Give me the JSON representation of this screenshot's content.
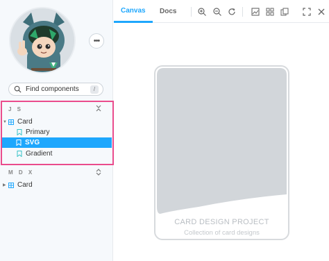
{
  "sidebar": {
    "search": {
      "placeholder": "Find components",
      "shortcut": "/"
    },
    "more_label": "•••",
    "sections": [
      {
        "title": "J S",
        "toggle": "⌃⌄",
        "component": "Card",
        "stories": [
          "Primary",
          "SVG",
          "Gradient"
        ],
        "selected_story": "SVG"
      },
      {
        "title": "M D X",
        "toggle": "⌃⌄",
        "component": "Card"
      }
    ]
  },
  "toolbar": {
    "tabs": [
      {
        "label": "Canvas",
        "active": true
      },
      {
        "label": "Docs",
        "active": false
      }
    ],
    "tools": [
      "zoom-in-icon",
      "zoom-out-icon",
      "reset-zoom-icon",
      "background-icon",
      "grid-icon",
      "outline-icon",
      "fullscreen-icon"
    ]
  },
  "canvas": {
    "card": {
      "title": "CARD DESIGN PROJECT",
      "subtitle": "Collection of card designs"
    }
  },
  "colors": {
    "accent": "#1ea7fd",
    "highlight_border": "#ea4c8c",
    "card_fill": "#d2d6da",
    "avatar_hoodie": "#4a7a86",
    "avatar_bg": "#d9dfe4"
  }
}
